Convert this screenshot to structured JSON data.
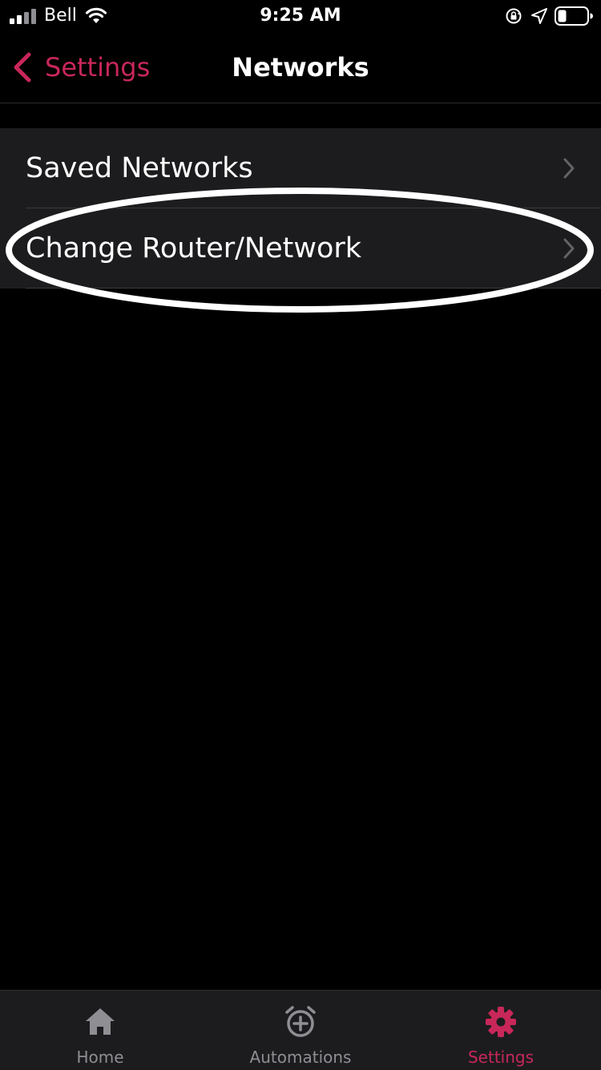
{
  "status_bar": {
    "carrier": "Bell",
    "time": "9:25 AM",
    "icons": [
      "signal-icon",
      "wifi-icon",
      "rotation-lock-icon",
      "location-icon",
      "battery-icon"
    ]
  },
  "nav": {
    "back_label": "Settings",
    "title": "Networks"
  },
  "list": {
    "items": [
      {
        "label": "Saved Networks"
      },
      {
        "label": "Change Router/Network",
        "highlighted": true
      }
    ]
  },
  "tab_bar": {
    "tabs": [
      {
        "label": "Home",
        "icon": "home-icon",
        "active": false
      },
      {
        "label": "Automations",
        "icon": "alarm-add-icon",
        "active": false
      },
      {
        "label": "Settings",
        "icon": "gear-icon",
        "active": true
      }
    ]
  },
  "colors": {
    "accent": "#c8275a",
    "background": "#000000",
    "row_background": "#1c1c1e",
    "inactive_tab": "#8e8e93"
  }
}
